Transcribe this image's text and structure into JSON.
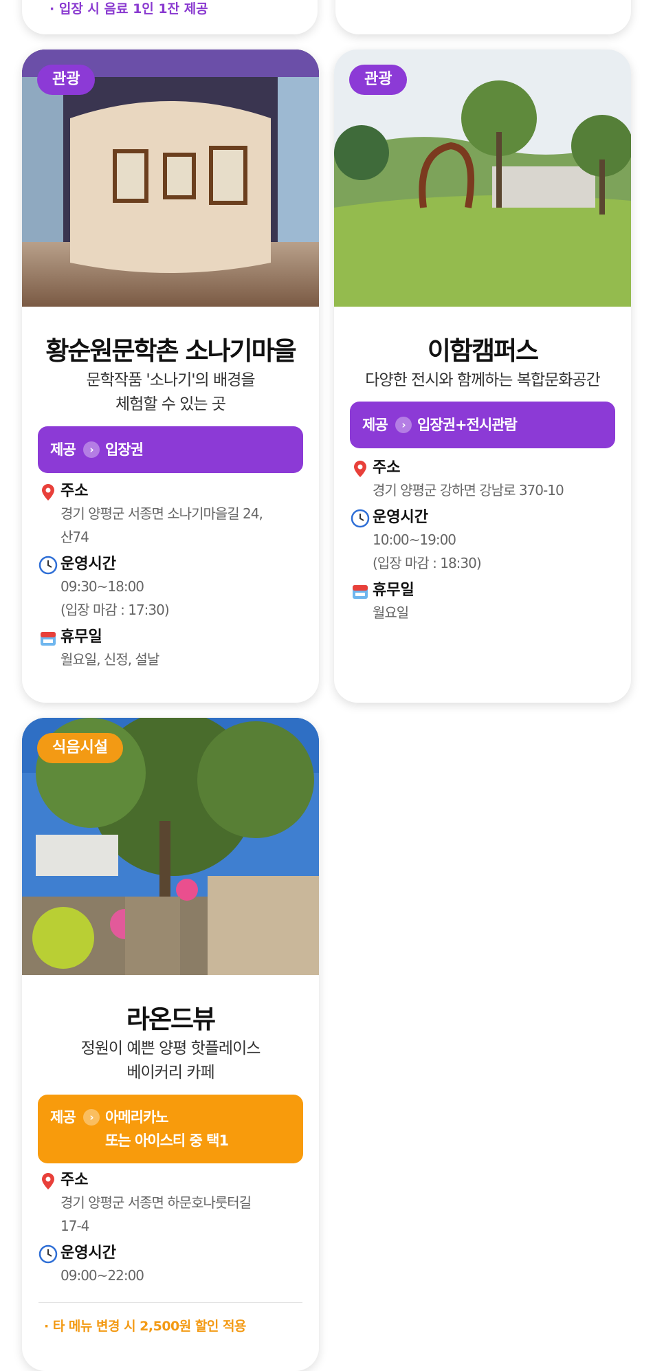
{
  "top": {
    "left_note": "· 입장 시 음료 1인 1잔 제공"
  },
  "cards": [
    {
      "badge": "관광",
      "title": "황순원문학촌 소나기마을",
      "subtitle_lines": [
        "문학작품 '소나기'의 배경을",
        "체험할 수 있는 곳"
      ],
      "offer_label": "제공",
      "offer_value": "입장권",
      "address_head": "주소",
      "address_lines": [
        "경기 양평군 서종면 소나기마을길 24,",
        "산74"
      ],
      "hours_head": "운영시간",
      "hours_lines": [
        "09:30~18:00",
        "(입장 마감 : 17:30)"
      ],
      "closed_head": "휴무일",
      "closed_lines": [
        "월요일, 신정, 설날"
      ]
    },
    {
      "badge": "관광",
      "title": "이함캠퍼스",
      "subtitle_lines": [
        "다양한 전시와 함께하는 복합문화공간"
      ],
      "offer_label": "제공",
      "offer_value": "입장권+전시관람",
      "address_head": "주소",
      "address_lines": [
        "경기 양평군 강하면 강남로 370-10"
      ],
      "hours_head": "운영시간",
      "hours_lines": [
        "10:00~19:00",
        "(입장 마감 : 18:30)"
      ],
      "closed_head": "휴무일",
      "closed_lines": [
        "월요일"
      ]
    },
    {
      "badge": "식음시설",
      "title": "라온드뷰",
      "subtitle_lines": [
        "정원이 예쁜 양평 핫플레이스",
        "베이커리 카페"
      ],
      "offer_label": "제공",
      "offer_value_lines": [
        "아메리카노",
        "또는 아이스티 중 택1"
      ],
      "address_head": "주소",
      "address_lines": [
        "경기 양평군 서종면 하문호나룻터길",
        "17-4"
      ],
      "hours_head": "운영시간",
      "hours_lines": [
        "09:00~22:00"
      ],
      "footnote": "· 타 메뉴 변경 시 2,500원 할인 적용"
    }
  ],
  "colors": {
    "purple": "#8c3ad6",
    "orange": "#f89b0c",
    "pin_red": "#e8403a",
    "clock_blue": "#2f6fd6"
  },
  "icons": [
    "location-pin-icon",
    "clock-icon",
    "calendar-icon",
    "chevron-right-icon"
  ]
}
